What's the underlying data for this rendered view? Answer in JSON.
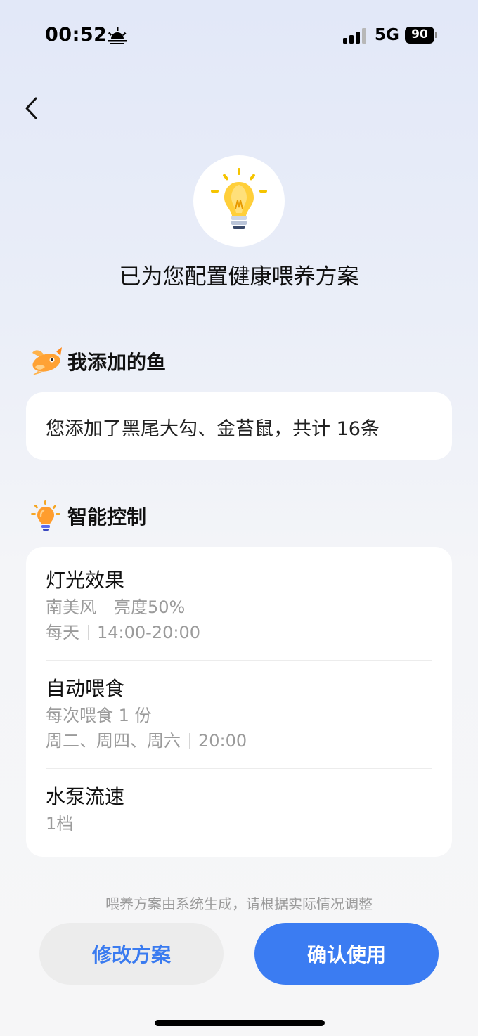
{
  "status_bar": {
    "time": "00:52",
    "network": "5G",
    "battery": "90",
    "icons": [
      "sunrise-icon",
      "signal-icon",
      "battery-icon"
    ]
  },
  "nav": {
    "back_icon": "chevron-left-icon"
  },
  "hero": {
    "icon": "lightbulb-icon",
    "title": "已为您配置健康喂养方案"
  },
  "fish_section": {
    "icon": "fish-icon",
    "title": "我添加的鱼",
    "summary": "您添加了黑尾大勾、金苔鼠，共计 16条"
  },
  "control_section": {
    "icon": "lightbulb-icon",
    "title": "智能控制",
    "items": [
      {
        "title": "灯光效果",
        "lines": [
          [
            "南美风",
            "亮度50%"
          ],
          [
            "每天",
            "14:00-20:00"
          ]
        ]
      },
      {
        "title": "自动喂食",
        "lines": [
          [
            "每次喂食 1 份"
          ],
          [
            "周二、周四、周六",
            "20:00"
          ]
        ]
      },
      {
        "title": "水泵流速",
        "lines": [
          [
            "1档"
          ]
        ]
      }
    ]
  },
  "footer": {
    "note": "喂养方案由系统生成，请根据实际情况调整",
    "modify_label": "修改方案",
    "confirm_label": "确认使用"
  },
  "colors": {
    "accent": "#3b7cf2",
    "secondary_button_bg": "#ececec",
    "muted_text": "#9b9b9b"
  }
}
